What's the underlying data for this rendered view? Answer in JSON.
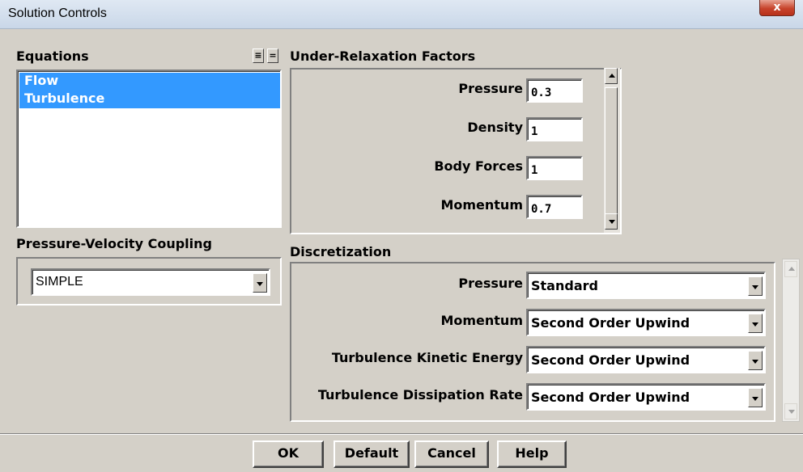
{
  "window": {
    "title": "Solution Controls",
    "close_glyph": "x"
  },
  "equations": {
    "heading": "Equations",
    "items": [
      {
        "label": "Flow",
        "selected": true
      },
      {
        "label": "Turbulence",
        "selected": true
      }
    ],
    "toggle_icons": [
      "select-all-icon",
      "deselect-all-icon"
    ]
  },
  "coupling": {
    "heading": "Pressure-Velocity Coupling",
    "selected": "SIMPLE"
  },
  "under_relaxation": {
    "heading": "Under-Relaxation Factors",
    "fields": [
      {
        "label": "Pressure",
        "value": "0.3"
      },
      {
        "label": "Density",
        "value": "1"
      },
      {
        "label": "Body Forces",
        "value": "1"
      },
      {
        "label": "Momentum",
        "value": "0.7"
      }
    ]
  },
  "discretization": {
    "heading": "Discretization",
    "fields": [
      {
        "label": "Pressure",
        "value": "Standard"
      },
      {
        "label": "Momentum",
        "value": "Second Order Upwind"
      },
      {
        "label": "Turbulence Kinetic Energy",
        "value": "Second Order Upwind"
      },
      {
        "label": "Turbulence Dissipation Rate",
        "value": "Second Order Upwind"
      }
    ]
  },
  "buttons": {
    "ok": "OK",
    "default": "Default",
    "cancel": "Cancel",
    "help": "Help"
  },
  "colors": {
    "dialog_bg": "#d4d0c8",
    "selection": "#3399ff",
    "close_button": "#c7432b"
  }
}
